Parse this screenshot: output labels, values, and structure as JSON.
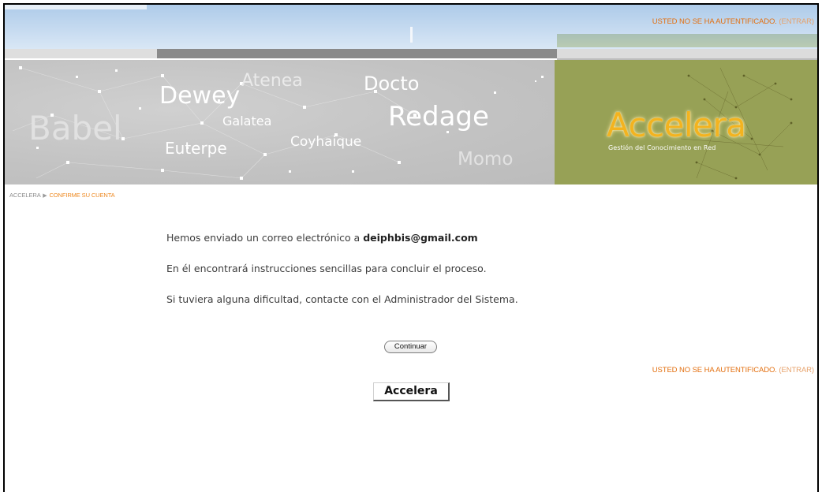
{
  "header": {
    "auth_status": "USTED NO SE HA AUTENTIFICADO.",
    "login_link": "(ENTRAR)"
  },
  "banner": {
    "projects": [
      "Atenea",
      "Docto",
      "Dewey",
      "Galatea",
      "Redage",
      "Babel",
      "Euterpe",
      "Coyhaique",
      "Momo"
    ],
    "brand": "Accelera",
    "tagline": "Gestión del Conocimiento en Red",
    "colors": {
      "brand_panel": "#97a156",
      "brand_text": "#f3b31f",
      "accent": "#e36f0f"
    }
  },
  "breadcrumb": {
    "home": "ACCELERA",
    "current": "CONFIRME SU CUENTA"
  },
  "message": {
    "line1_prefix": "Hemos enviado un correo electrónico a",
    "email": "deiphbis@gmail.com",
    "line2": "En él encontrará instrucciones sencillas para concluir el proceso.",
    "line3": "Si tuviera alguna dificultad, contacte con el Administrador del Sistema."
  },
  "actions": {
    "continue_label": "Continuar"
  },
  "footer": {
    "auth_status": "USTED NO SE HA AUTENTIFICADO.",
    "login_link": "(ENTRAR)",
    "home_button": "Accelera"
  }
}
